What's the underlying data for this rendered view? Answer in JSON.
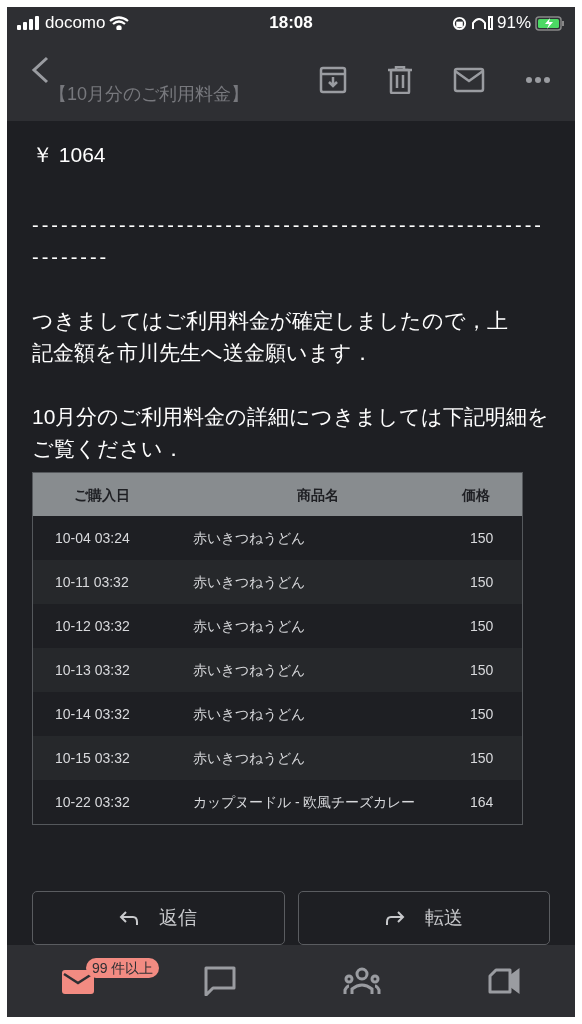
{
  "status_bar": {
    "carrier": "docomo",
    "time": "18:08",
    "battery": "91%"
  },
  "header": {
    "title": "【10月分のご利用料金】"
  },
  "body": {
    "amount": "￥ 1064",
    "separator": "-------------------------------------------------------------",
    "paragraph_1": "つきましてはご利用料金が確定しましたので，上記金額を市川先生へ送金願います．",
    "paragraph_2": "10月分のご利用料金の詳細につきましては下記明細をご覧ください．"
  },
  "table": {
    "columns": [
      "ご購入日",
      "商品名",
      "価格"
    ],
    "rows": [
      [
        "10-04 03:24",
        "赤いきつねうどん",
        "150"
      ],
      [
        "10-11 03:32",
        "赤いきつねうどん",
        "150"
      ],
      [
        "10-12 03:32",
        "赤いきつねうどん",
        "150"
      ],
      [
        "10-13 03:32",
        "赤いきつねうどん",
        "150"
      ],
      [
        "10-14 03:32",
        "赤いきつねうどん",
        "150"
      ],
      [
        "10-15 03:32",
        "赤いきつねうどん",
        "150"
      ],
      [
        "10-22 03:32",
        "カップヌードル - 欧風チーズカレー",
        "164"
      ]
    ]
  },
  "actions": [
    {
      "kind": "reply",
      "label": "返信"
    },
    {
      "kind": "forward",
      "label": "転送"
    }
  ],
  "bottom_nav": [
    {
      "kind": "mail",
      "selected": true,
      "badge": "99 件以上"
    },
    {
      "kind": "chat",
      "selected": false
    },
    {
      "kind": "people",
      "selected": false
    },
    {
      "kind": "video",
      "selected": false
    }
  ]
}
